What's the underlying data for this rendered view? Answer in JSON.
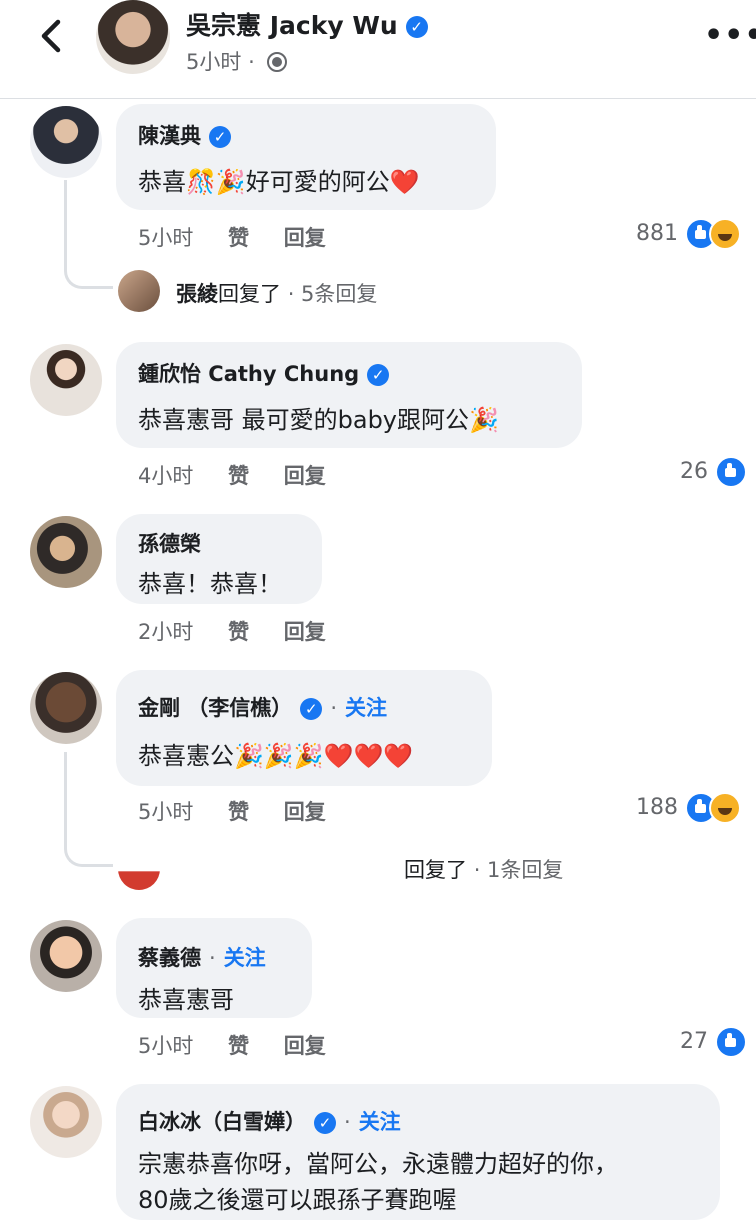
{
  "header": {
    "author": "吳宗憲 Jacky Wu",
    "time": "5小时",
    "separator": "·",
    "more_label": "•••"
  },
  "labels": {
    "like": "赞",
    "reply": "回复",
    "follow": "关注"
  },
  "comments": [
    {
      "name": "陳漢典",
      "verified": true,
      "text": "恭喜🎊🎉好可愛的阿公❤️",
      "time": "5小时",
      "reactions": "881",
      "reaction_types": [
        "like",
        "haha"
      ],
      "reply_summary": {
        "author": "張綾",
        "text": "回复了",
        "count": "· 5条回复"
      }
    },
    {
      "name": "鍾欣怡 Cathy Chung",
      "verified": true,
      "text": "恭喜憲哥 最可愛的baby跟阿公🎉",
      "time": "4小时",
      "reactions": "26",
      "reaction_types": [
        "like"
      ]
    },
    {
      "name": "孫德榮",
      "verified": false,
      "text": "恭喜！恭喜！",
      "time": "2小时"
    },
    {
      "name": "金剛 （李信樵）",
      "verified": true,
      "follow": true,
      "text": "恭喜憲公🎉🎉🎉❤️❤️❤️",
      "time": "5小时",
      "reactions": "188",
      "reaction_types": [
        "like",
        "haha"
      ],
      "reply_summary": {
        "author": "",
        "text": "回复了",
        "count": "· 1条回复"
      }
    },
    {
      "name": "蔡義德",
      "verified": false,
      "follow": true,
      "text": "恭喜憲哥",
      "time": "5小时",
      "reactions": "27",
      "reaction_types": [
        "like"
      ]
    },
    {
      "name": "白冰冰（白雪嬅）",
      "verified": true,
      "follow": true,
      "text_line1": "宗憲恭喜你呀，當阿公，永遠體力超好的你，",
      "text_line2": "80歲之後還可以跟孫子賽跑喔"
    }
  ]
}
